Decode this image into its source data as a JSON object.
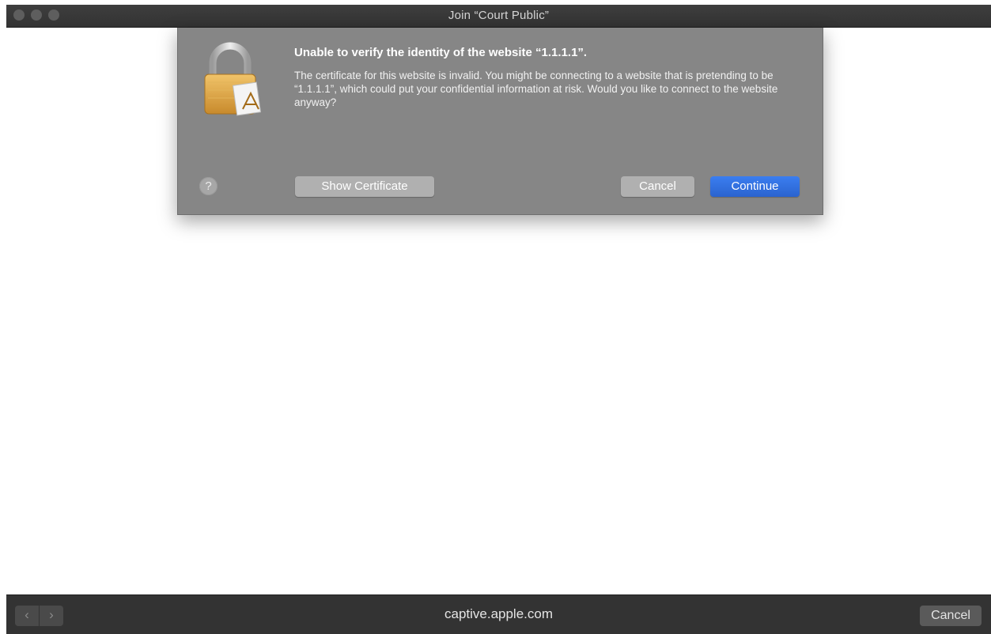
{
  "window": {
    "title": "Join “Court Public”"
  },
  "alert": {
    "title": "Unable to verify the identity of the website “1.1.1.1”.",
    "message": "The certificate for this website is invalid. You might be connecting to a website that is pretending to be “1.1.1.1”, which could put your confidential information at risk. Would you like to connect to the website anyway?",
    "help_label": "?",
    "show_certificate_label": "Show Certificate",
    "cancel_label": "Cancel",
    "continue_label": "Continue",
    "icon": "lock-certificate-icon"
  },
  "toolbar": {
    "back_label": "‹",
    "forward_label": "›",
    "url": "captive.apple.com",
    "cancel_label": "Cancel"
  },
  "colors": {
    "accent": "#2f6fde",
    "sheet": "#868686",
    "titlebar": "#3a3a3a"
  }
}
